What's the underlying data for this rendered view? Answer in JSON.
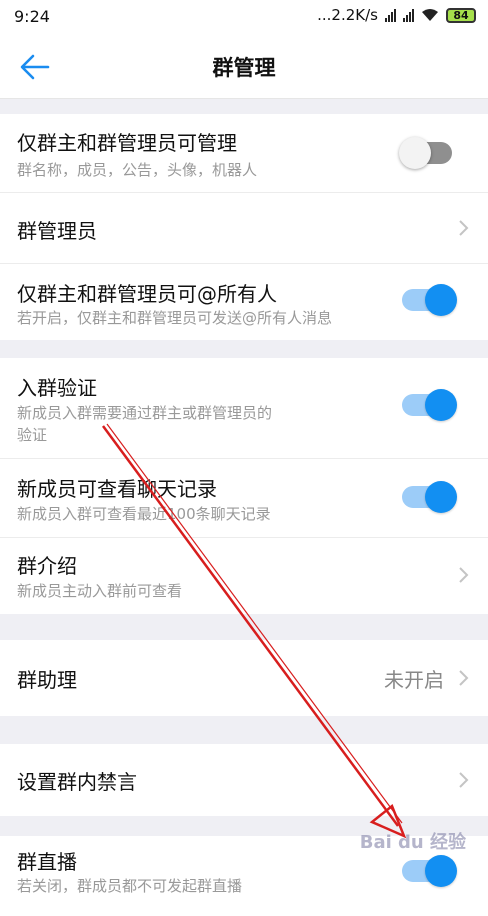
{
  "status_bar": {
    "time": "9:24",
    "network_speed": "...2.2K/s",
    "battery": "84"
  },
  "header": {
    "title": "群管理"
  },
  "settings": [
    {
      "label": "仅群主和群管理员可管理",
      "sub": "群名称，成员，公告，头像，机器人",
      "toggle": "off"
    },
    {
      "label": "群管理员"
    },
    {
      "label": "仅群主和群管理员可@所有人",
      "sub": "若开启，仅群主和群管理员可发送@所有人消息",
      "toggle": "on"
    },
    {
      "label": "入群验证",
      "sub": "新成员入群需要通过群主或群管理员的",
      "sub2": "验证",
      "toggle": "on"
    },
    {
      "label": "新成员可查看聊天记录",
      "sub": "新成员入群可查看最近100条聊天记录",
      "toggle": "on"
    },
    {
      "label": "群介绍",
      "sub": "新成员主动入群前可查看"
    },
    {
      "label": "群助理",
      "value": "未开启"
    },
    {
      "label": "设置群内禁言"
    },
    {
      "label": "群直播",
      "sub": "若关闭，群成员都不可发起群直播",
      "toggle": "on"
    }
  ],
  "watermark": "Bai du 经验",
  "colors": {
    "accent": "#128ff2",
    "annotation_arrow": "#d81e1e"
  }
}
